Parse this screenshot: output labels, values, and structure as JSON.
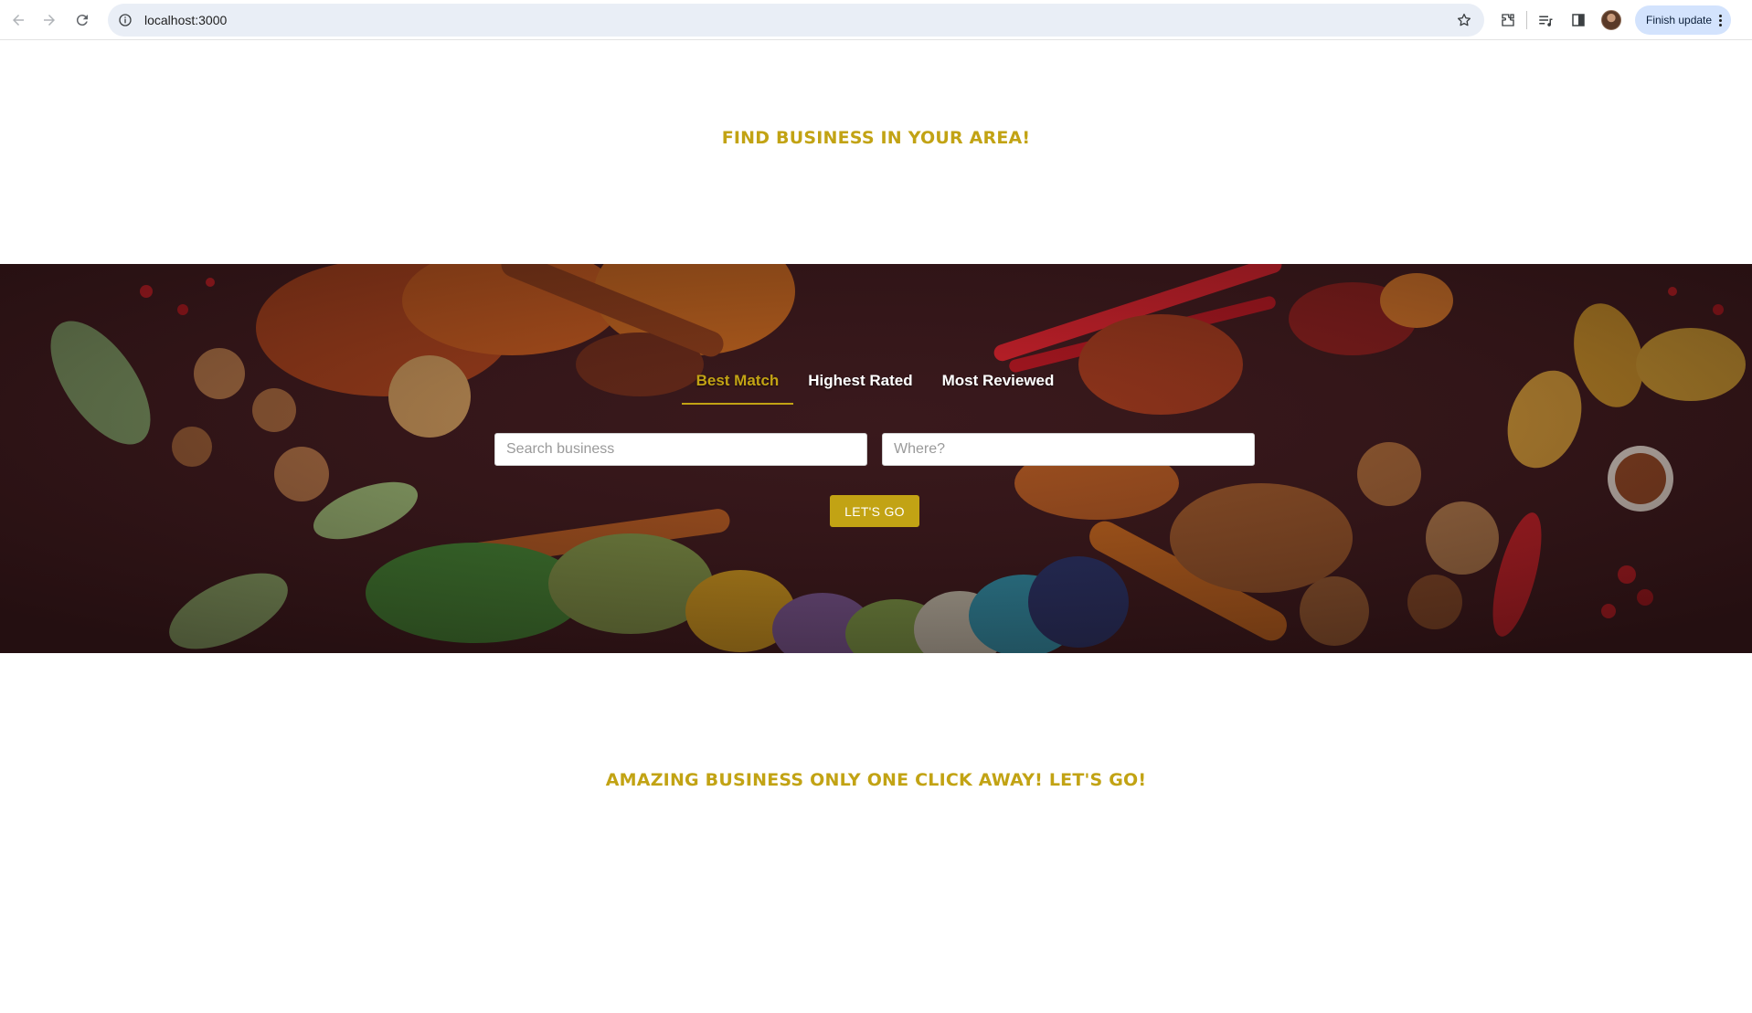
{
  "browser": {
    "url": "localhost:3000",
    "finish_update_label": "Finish update",
    "icons": [
      "back-icon",
      "forward-icon",
      "reload-icon",
      "site-info-icon",
      "bookmark-star-icon",
      "extensions-icon",
      "reading-list-icon",
      "side-panel-icon",
      "profile-avatar",
      "menu-kebab-icon"
    ]
  },
  "page": {
    "top_heading": "FIND BUSINESS IN YOUR AREA!",
    "bottom_heading": "AMAZING BUSINESS ONLY ONE CLICK AWAY! LET'S GO!",
    "accent_color": "#c2a314"
  },
  "search": {
    "tabs": [
      {
        "label": "Best Match",
        "active": true
      },
      {
        "label": "Highest Rated",
        "active": false
      },
      {
        "label": "Most Reviewed",
        "active": false
      }
    ],
    "business_placeholder": "Search business",
    "location_placeholder": "Where?",
    "submit_label": "LET'S GO"
  }
}
